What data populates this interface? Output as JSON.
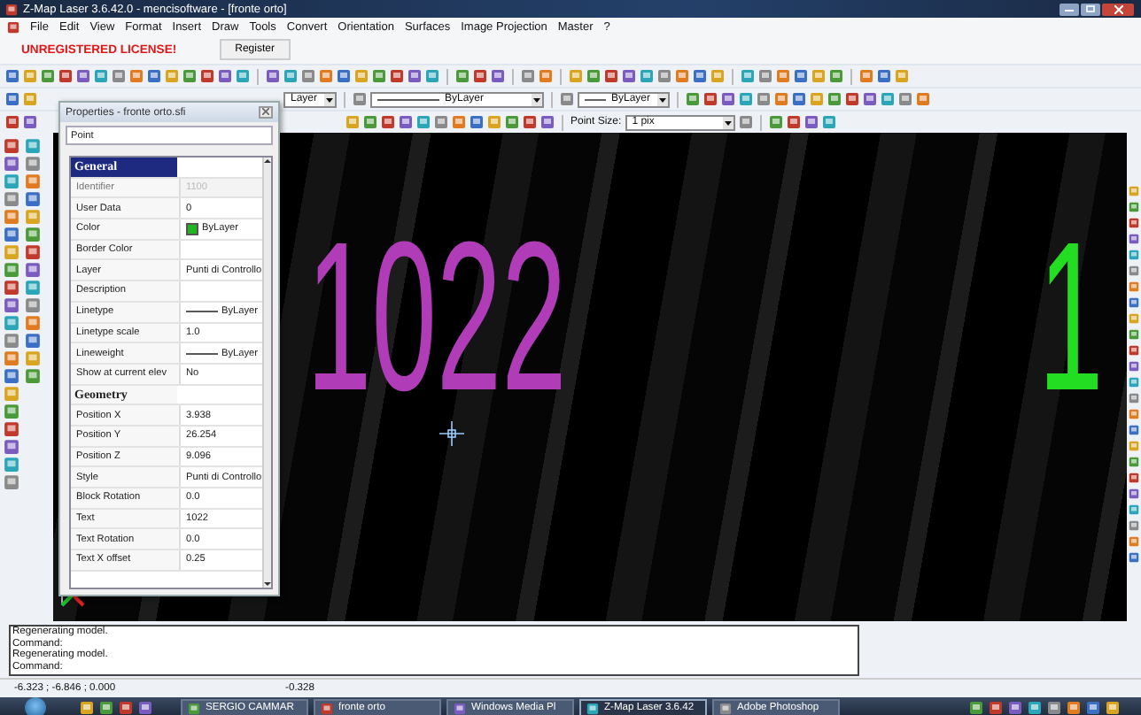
{
  "window": {
    "title": "Z-Map Laser 3.6.42.0 - mencisoftware - [fronte orto]"
  },
  "menu": [
    "File",
    "Edit",
    "View",
    "Format",
    "Insert",
    "Draw",
    "Tools",
    "Convert",
    "Orientation",
    "Surfaces",
    "Image Projection",
    "Master",
    "?"
  ],
  "license": {
    "warning": "UNREGISTERED LICENSE!",
    "button": "Register"
  },
  "toolbar": {
    "layer_dropdown": "Layer",
    "linetype_dropdown": "ByLayer",
    "lineweight_dropdown": "ByLayer",
    "point_size_label": "Point Size:",
    "point_size_dropdown": "1 pix"
  },
  "properties": {
    "title": "Properties - fronte orto.sfi",
    "object_type": "Point",
    "sections": [
      {
        "name": "General",
        "rows": [
          {
            "kind": "text",
            "name": "Identifier",
            "value": "1100",
            "disabled": true
          },
          {
            "kind": "text",
            "name": "User Data",
            "value": "0",
            "disabled": false
          },
          {
            "kind": "color",
            "name": "Color",
            "value": "ByLayer",
            "color": "#22b522",
            "disabled": false
          },
          {
            "kind": "text",
            "name": "Border Color",
            "disabled": false
          },
          {
            "kind": "text",
            "name": "Layer",
            "value": "Punti di Controllo",
            "disabled": false
          },
          {
            "kind": "text",
            "name": "Description",
            "disabled": false
          },
          {
            "kind": "line",
            "name": "Linetype",
            "value": "ByLayer",
            "disabled": false
          },
          {
            "kind": "text",
            "name": "Linetype scale",
            "value": "1.0",
            "disabled": false
          },
          {
            "kind": "line",
            "name": "Lineweight",
            "value": "ByLayer",
            "disabled": false
          },
          {
            "kind": "text",
            "name": "Show at current elev",
            "value": "No",
            "disabled": false
          }
        ]
      },
      {
        "name": "Geometry",
        "rows": [
          {
            "kind": "text",
            "name": "Position X",
            "value": "3.938",
            "disabled": false
          },
          {
            "kind": "text",
            "name": "Position Y",
            "value": "26.254",
            "disabled": false
          },
          {
            "kind": "text",
            "name": "Position Z",
            "value": "9.096",
            "disabled": false
          },
          {
            "kind": "text",
            "name": "Style",
            "value": "Punti di Controllo",
            "disabled": false
          },
          {
            "kind": "text",
            "name": "Block Rotation",
            "value": "0.0",
            "disabled": false
          },
          {
            "kind": "text",
            "name": "Text",
            "value": "1022",
            "disabled": false
          },
          {
            "kind": "text",
            "name": "Text Rotation",
            "value": "0.0",
            "disabled": false
          },
          {
            "kind": "text",
            "name": "Text X offset",
            "value": "0.25",
            "disabled": false
          }
        ]
      }
    ]
  },
  "canvas": {
    "labels": [
      {
        "text": "1022",
        "color": "#b03cb8"
      },
      {
        "text": "1",
        "color": "#22dd22"
      }
    ]
  },
  "command_log": [
    "Regenerating model.",
    "Command:",
    "Regenerating model.",
    "Command:"
  ],
  "status_bar": {
    "coordinates": "-6.323 ; -6.846 ; 0.000",
    "value": "-0.328"
  },
  "taskbar": {
    "items": [
      {
        "label": "SERGIO CAMMAR",
        "selected": false
      },
      {
        "label": "fronte orto",
        "selected": false
      },
      {
        "label": "Windows Media Pl",
        "selected": false
      },
      {
        "label": "Z-Map Laser 3.6.42",
        "selected": true
      },
      {
        "label": "Adobe Photoshop",
        "selected": false
      }
    ]
  }
}
